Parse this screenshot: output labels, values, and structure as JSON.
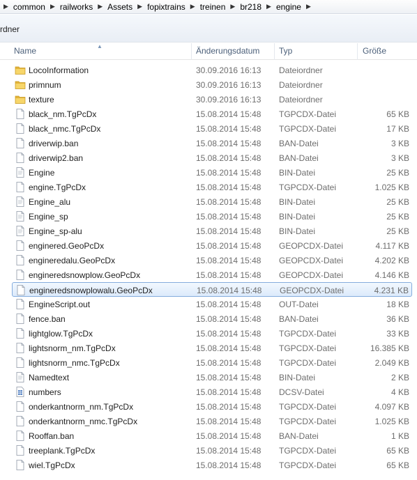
{
  "breadcrumb": [
    "common",
    "railworks",
    "Assets",
    "fopixtrains",
    "treinen",
    "br218",
    "engine"
  ],
  "toolbar": {
    "partial_label": "rdner"
  },
  "columns": {
    "name": "Name",
    "date": "Änderungsdatum",
    "type": "Typ",
    "size": "Größe"
  },
  "files": [
    {
      "name": "LocoInformation",
      "date": "30.09.2016 16:13",
      "type": "Dateiordner",
      "size": "",
      "icon": "folder-icon"
    },
    {
      "name": "primnum",
      "date": "30.09.2016 16:13",
      "type": "Dateiordner",
      "size": "",
      "icon": "folder-icon"
    },
    {
      "name": "texture",
      "date": "30.09.2016 16:13",
      "type": "Dateiordner",
      "size": "",
      "icon": "folder-icon"
    },
    {
      "name": "black_nm.TgPcDx",
      "date": "15.08.2014 15:48",
      "type": "TGPCDX-Datei",
      "size": "65 KB",
      "icon": "file-icon"
    },
    {
      "name": "black_nmc.TgPcDx",
      "date": "15.08.2014 15:48",
      "type": "TGPCDX-Datei",
      "size": "17 KB",
      "icon": "file-icon"
    },
    {
      "name": "driverwip.ban",
      "date": "15.08.2014 15:48",
      "type": "BAN-Datei",
      "size": "3 KB",
      "icon": "file-icon"
    },
    {
      "name": "driverwip2.ban",
      "date": "15.08.2014 15:48",
      "type": "BAN-Datei",
      "size": "3 KB",
      "icon": "file-icon"
    },
    {
      "name": "Engine",
      "date": "15.08.2014 15:48",
      "type": "BIN-Datei",
      "size": "25 KB",
      "icon": "document-icon"
    },
    {
      "name": "engine.TgPcDx",
      "date": "15.08.2014 15:48",
      "type": "TGPCDX-Datei",
      "size": "1.025 KB",
      "icon": "file-icon"
    },
    {
      "name": "Engine_alu",
      "date": "15.08.2014 15:48",
      "type": "BIN-Datei",
      "size": "25 KB",
      "icon": "document-icon"
    },
    {
      "name": "Engine_sp",
      "date": "15.08.2014 15:48",
      "type": "BIN-Datei",
      "size": "25 KB",
      "icon": "document-icon"
    },
    {
      "name": "Engine_sp-alu",
      "date": "15.08.2014 15:48",
      "type": "BIN-Datei",
      "size": "25 KB",
      "icon": "document-icon"
    },
    {
      "name": "enginered.GeoPcDx",
      "date": "15.08.2014 15:48",
      "type": "GEOPCDX-Datei",
      "size": "4.117 KB",
      "icon": "file-icon"
    },
    {
      "name": "engineredalu.GeoPcDx",
      "date": "15.08.2014 15:48",
      "type": "GEOPCDX-Datei",
      "size": "4.202 KB",
      "icon": "file-icon"
    },
    {
      "name": "engineredsnowplow.GeoPcDx",
      "date": "15.08.2014 15:48",
      "type": "GEOPCDX-Datei",
      "size": "4.146 KB",
      "icon": "file-icon"
    },
    {
      "name": "engineredsnowplowalu.GeoPcDx",
      "date": "15.08.2014 15:48",
      "type": "GEOPCDX-Datei",
      "size": "4.231 KB",
      "icon": "file-icon",
      "selected": true
    },
    {
      "name": "EngineScript.out",
      "date": "15.08.2014 15:48",
      "type": "OUT-Datei",
      "size": "18 KB",
      "icon": "file-icon"
    },
    {
      "name": "fence.ban",
      "date": "15.08.2014 15:48",
      "type": "BAN-Datei",
      "size": "36 KB",
      "icon": "file-icon"
    },
    {
      "name": "lightglow.TgPcDx",
      "date": "15.08.2014 15:48",
      "type": "TGPCDX-Datei",
      "size": "33 KB",
      "icon": "file-icon"
    },
    {
      "name": "lightsnorm_nm.TgPcDx",
      "date": "15.08.2014 15:48",
      "type": "TGPCDX-Datei",
      "size": "16.385 KB",
      "icon": "file-icon"
    },
    {
      "name": "lightsnorm_nmc.TgPcDx",
      "date": "15.08.2014 15:48",
      "type": "TGPCDX-Datei",
      "size": "2.049 KB",
      "icon": "file-icon"
    },
    {
      "name": "Namedtext",
      "date": "15.08.2014 15:48",
      "type": "BIN-Datei",
      "size": "2 KB",
      "icon": "document-icon"
    },
    {
      "name": "numbers",
      "date": "15.08.2014 15:48",
      "type": "DCSV-Datei",
      "size": "4 KB",
      "icon": "table-file-icon"
    },
    {
      "name": "onderkantnorm_nm.TgPcDx",
      "date": "15.08.2014 15:48",
      "type": "TGPCDX-Datei",
      "size": "4.097 KB",
      "icon": "file-icon"
    },
    {
      "name": "onderkantnorm_nmc.TgPcDx",
      "date": "15.08.2014 15:48",
      "type": "TGPCDX-Datei",
      "size": "1.025 KB",
      "icon": "file-icon"
    },
    {
      "name": "Rooffan.ban",
      "date": "15.08.2014 15:48",
      "type": "BAN-Datei",
      "size": "1 KB",
      "icon": "file-icon"
    },
    {
      "name": "treeplank.TgPcDx",
      "date": "15.08.2014 15:48",
      "type": "TGPCDX-Datei",
      "size": "65 KB",
      "icon": "file-icon"
    },
    {
      "name": "wiel.TgPcDx",
      "date": "15.08.2014 15:48",
      "type": "TGPCDX-Datei",
      "size": "65 KB",
      "icon": "file-icon"
    }
  ],
  "colors": {
    "selection_border": "#84acdd",
    "selection_fill": "#dceafb",
    "folder": "#e8b93a",
    "header_text": "#4c607a"
  }
}
